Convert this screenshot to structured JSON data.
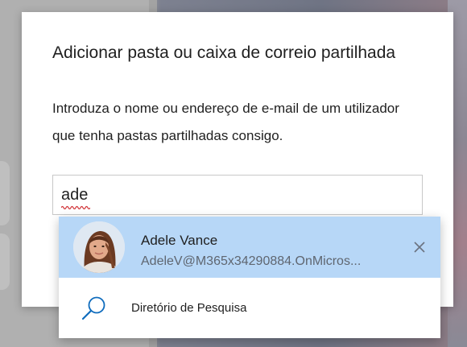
{
  "dialog": {
    "title": "Adicionar pasta ou caixa de correio partilhada",
    "description_line1": "Introduza o nome ou endereço de e-mail de um utilizador",
    "description_line2": "que tenha pastas partilhadas consigo."
  },
  "search": {
    "value": "ade",
    "spellcheck_flagged": true
  },
  "suggestions": {
    "person": {
      "name": "Adele Vance",
      "email": "AdeleV@M365x34290884.OnMicros...",
      "avatar_icon": "person-photo",
      "dismiss_icon": "close-icon",
      "highlight_color": "#b7d7f7"
    },
    "directory": {
      "label": "Diretório de Pesquisa",
      "icon": "search-icon",
      "icon_color": "#0f6cbd"
    }
  }
}
